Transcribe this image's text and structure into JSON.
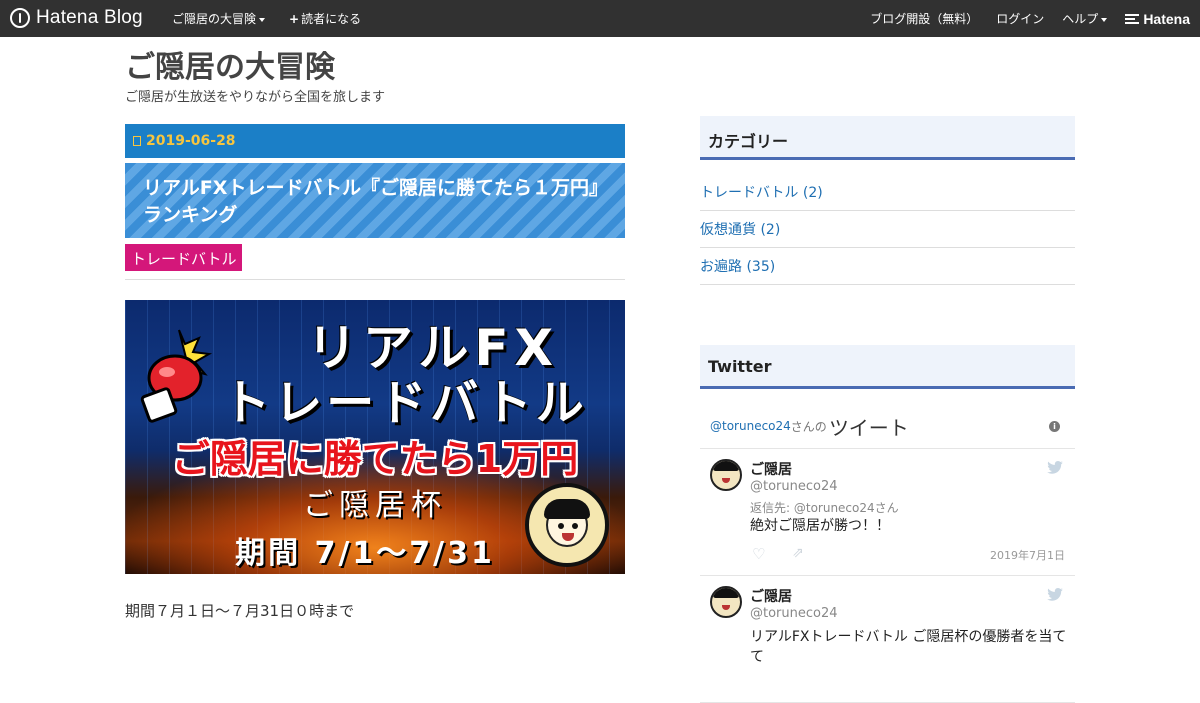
{
  "topbar": {
    "logo_text": "Hatena Blog",
    "blog_menu": "ご隠居の大冒険",
    "subscribe": "読者になる",
    "open_blog": "ブログ開設（無料）",
    "login": "ログイン",
    "help": "ヘルプ",
    "brand": "Hatena"
  },
  "header": {
    "title": "ご隠居の大冒険",
    "description": "ご隠居が生放送をやりながら全国を旅します"
  },
  "entry": {
    "date": "2019-06-28",
    "title": "リアルFXトレードバトル『ご隠居に勝てたら１万円』ランキング",
    "category": "トレードバトル",
    "image": {
      "line1": "リアルFX",
      "line2": "トレードバトル",
      "line3": "ご隠居に勝てたら1万円",
      "line4": "ご隠居杯",
      "line5": "期間 7/1〜7/31"
    },
    "period_text": "期間７月１日～７月31日０時まで"
  },
  "sidebar": {
    "categories_title": "カテゴリー",
    "categories": [
      {
        "label": "トレードバトル (2)"
      },
      {
        "label": "仮想通貨 (2)"
      },
      {
        "label": "お遍路 (35)"
      }
    ],
    "twitter_title": "Twitter",
    "twitter": {
      "handle": "@toruneco24",
      "san_no": "さんの",
      "tweets_label": "ツイート",
      "info_glyph": "i",
      "tweets": [
        {
          "name": "ご隠居",
          "username": "@toruneco24",
          "reply_prefix": "返信先: ",
          "reply_to": "@toruneco24さん",
          "body": "絶対ご隠居が勝つ！！",
          "date": "2019年7月1日"
        },
        {
          "name": "ご隠居",
          "username": "@toruneco24",
          "body": "リアルFXトレードバトル ご隠居杯の優勝者を当てて"
        }
      ]
    }
  },
  "colors": {
    "topbar": "#313131",
    "date_bar": "#1b7fc7",
    "date_text": "#f7c53f",
    "category_tag": "#d4177a",
    "sidebar_accent": "#4a6bb3",
    "link": "#1f6fb2"
  }
}
